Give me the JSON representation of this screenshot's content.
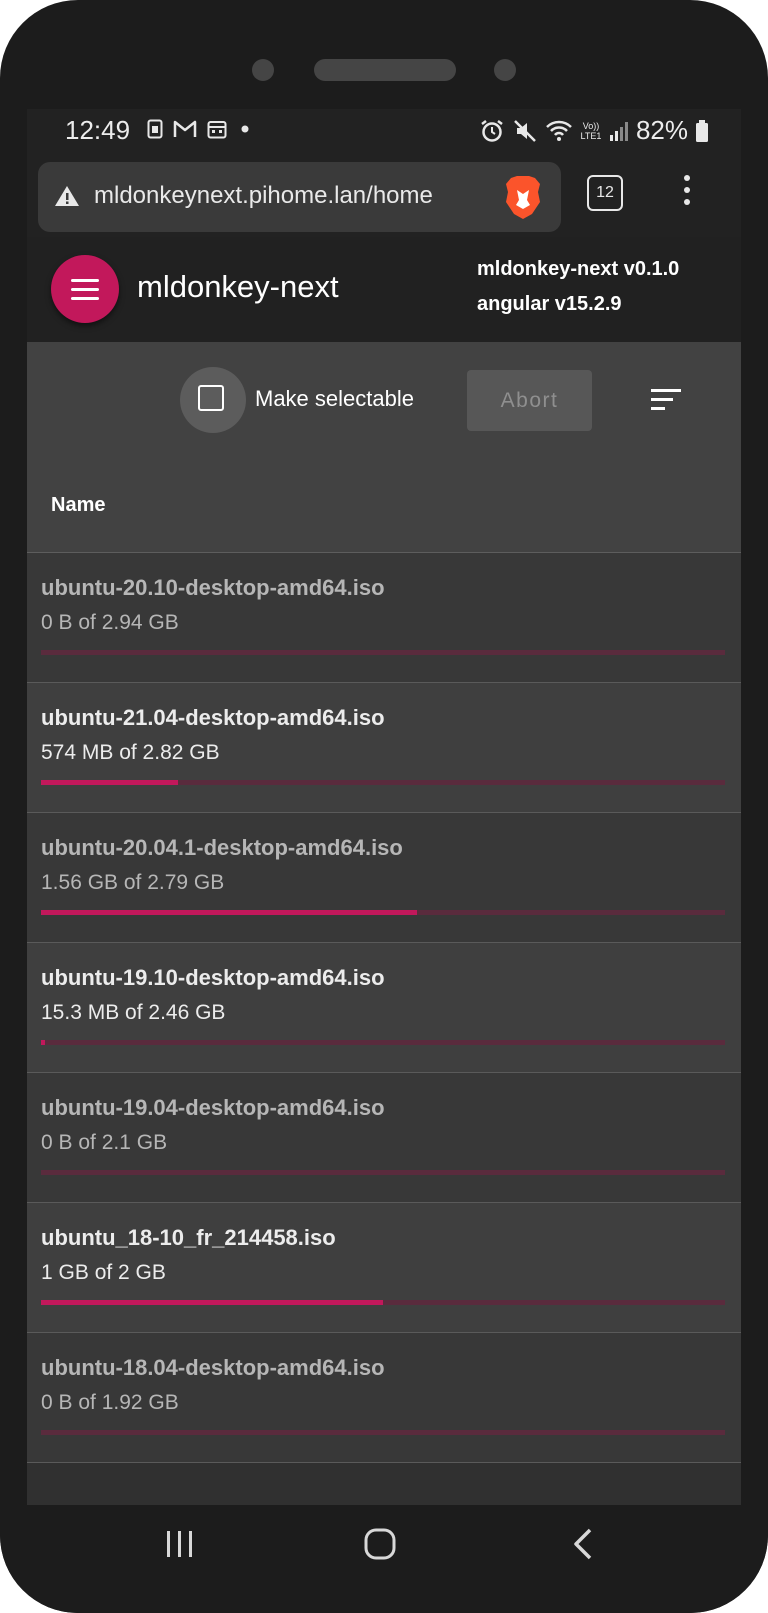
{
  "status_bar": {
    "time": "12:49",
    "battery": "82%",
    "left_icons": [
      "sim-card-icon",
      "gmail-icon",
      "calendar-icon",
      "dot-icon"
    ],
    "right_icons": [
      "alarm-icon",
      "mute-icon",
      "wifi-icon",
      "volte-icon",
      "signal-icon",
      "battery-icon"
    ],
    "volte_label": "Vo)) LTE1"
  },
  "browser": {
    "url": "mldonkeynext.pihome.lan/home",
    "tab_count": "12"
  },
  "toolbar": {
    "title": "mldonkey-next",
    "version_line1": "mldonkey-next v0.1.0",
    "version_line2": "angular v15.2.9"
  },
  "actions": {
    "checkbox_label": "Make selectable",
    "abort_label": "Abort"
  },
  "table": {
    "header_name": "Name",
    "rows": [
      {
        "name": "ubuntu-20.10-desktop-amd64.iso",
        "size": "0 B of 2.94 GB",
        "progress": 0.0,
        "style": "dim"
      },
      {
        "name": "ubuntu-21.04-desktop-amd64.iso",
        "size": "574 MB of 2.82 GB",
        "progress": 0.2,
        "style": "bright"
      },
      {
        "name": "ubuntu-20.04.1-desktop-amd64.iso",
        "size": "1.56 GB of 2.79 GB",
        "progress": 0.55,
        "style": "dim"
      },
      {
        "name": "ubuntu-19.10-desktop-amd64.iso",
        "size": "15.3 MB of 2.46 GB",
        "progress": 0.006,
        "style": "bright"
      },
      {
        "name": "ubuntu-19.04-desktop-amd64.iso",
        "size": "0 B of 2.1 GB",
        "progress": 0.0,
        "style": "dim"
      },
      {
        "name": "ubuntu_18-10_fr_214458.iso",
        "size": "1 GB of 2 GB",
        "progress": 0.5,
        "style": "bright"
      },
      {
        "name": "ubuntu-18.04-desktop-amd64.iso",
        "size": "0 B of 1.92 GB",
        "progress": 0.0,
        "style": "dim"
      }
    ]
  },
  "colors": {
    "accent": "#c2185b",
    "track": "#5a2b3d"
  }
}
